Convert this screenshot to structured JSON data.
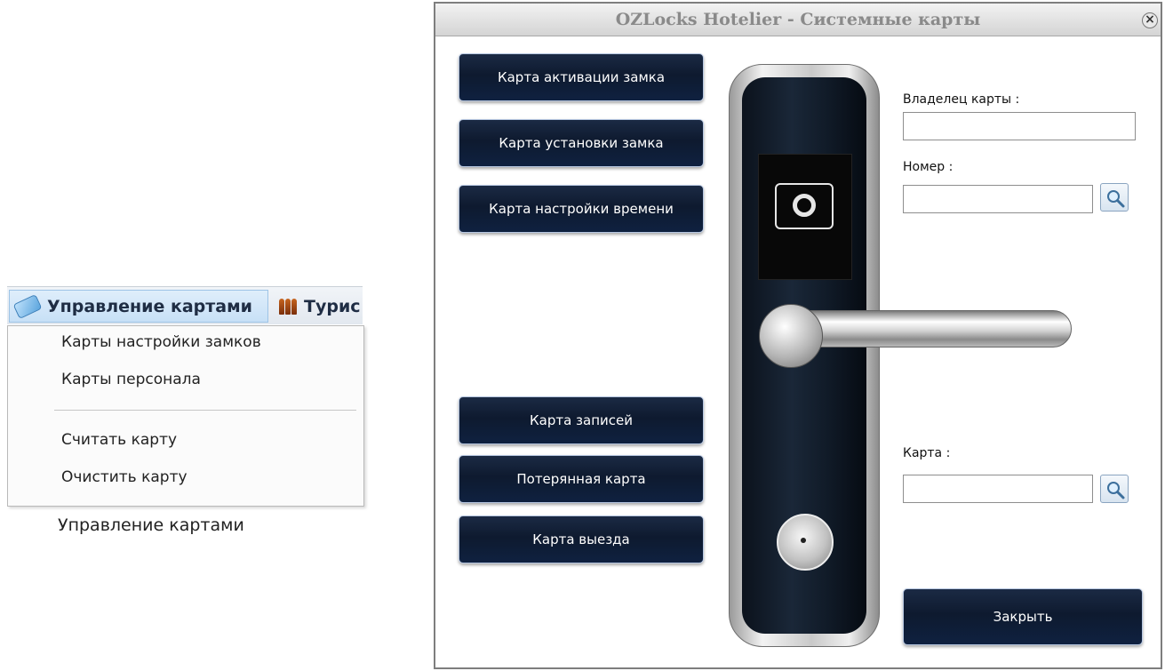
{
  "menu": {
    "bar_items": [
      {
        "label": "Управление картами",
        "icon": "card-icon"
      },
      {
        "label": "Турис",
        "icon": "people-icon"
      }
    ],
    "dropdown_items": [
      "Карты настройки замков",
      "Карты персонала",
      "Считать карту",
      "Очистить карту"
    ],
    "caption": "Управление картами"
  },
  "dialog": {
    "title": "OZLocks Hotelier - Системные карты",
    "close_symbol": "×",
    "buttons_top": [
      "Карта активации замка",
      "Карта установки замка",
      "Карта настройки времени"
    ],
    "buttons_bottom": [
      "Карта записей",
      "Потерянная карта",
      "Карта выезда"
    ],
    "fields": {
      "owner_label": "Владелец карты :",
      "owner_value": "",
      "number_label": "Номер :",
      "number_value": "",
      "card_label": "Карта :",
      "card_value": ""
    },
    "close_button": "Закрыть",
    "colors": {
      "button_dark": "#0e1a2f",
      "button_border": "#b8c8e2",
      "title_text": "#8a8a8a"
    }
  }
}
